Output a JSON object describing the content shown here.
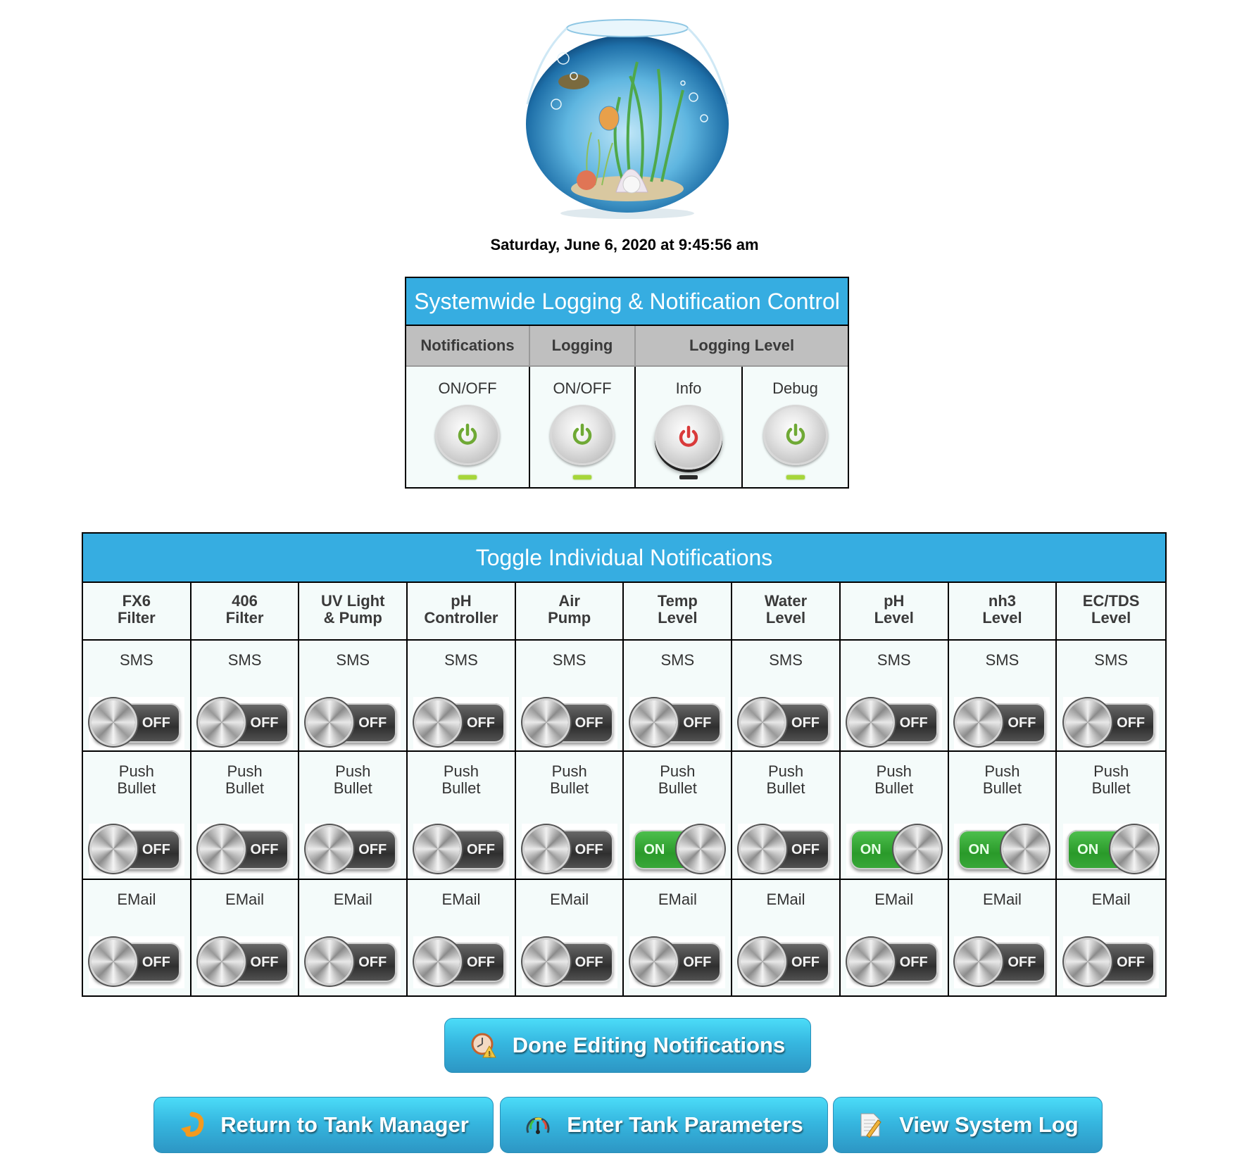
{
  "header": {
    "logo_icon": "fishbowl-aquarium-image",
    "datetime": "Saturday, June 6, 2020 at 9:45:56 am"
  },
  "systemwide": {
    "title": "Systemwide Logging & Notification Control",
    "headers": [
      "Notifications",
      "Logging",
      "Logging Level"
    ],
    "controls": [
      {
        "label": "ON/OFF",
        "group": "Notifications",
        "state": "on",
        "icon_color": "#6fa935",
        "icon": "power-icon"
      },
      {
        "label": "ON/OFF",
        "group": "Logging",
        "state": "on",
        "icon_color": "#6fa935",
        "icon": "power-icon"
      },
      {
        "label": "Info",
        "group": "Logging Level",
        "state": "off",
        "icon_color": "#d93a3a",
        "icon": "power-icon"
      },
      {
        "label": "Debug",
        "group": "Logging Level",
        "state": "on",
        "icon_color": "#6fa935",
        "icon": "power-icon"
      }
    ]
  },
  "individual": {
    "title": "Toggle Individual Notifications",
    "columns": [
      {
        "line1": "FX6",
        "line2": "Filter"
      },
      {
        "line1": "406",
        "line2": "Filter"
      },
      {
        "line1": "UV Light",
        "line2": "& Pump"
      },
      {
        "line1": "pH",
        "line2": "Controller"
      },
      {
        "line1": "Air",
        "line2": "Pump"
      },
      {
        "line1": "Temp",
        "line2": "Level"
      },
      {
        "line1": "Water",
        "line2": "Level"
      },
      {
        "line1": "pH",
        "line2": "Level"
      },
      {
        "line1": "nh3",
        "line2": "Level"
      },
      {
        "line1": "EC/TDS",
        "line2": "Level"
      }
    ],
    "rows": [
      {
        "label1": "SMS",
        "label2": "",
        "states": [
          "OFF",
          "OFF",
          "OFF",
          "OFF",
          "OFF",
          "OFF",
          "OFF",
          "OFF",
          "OFF",
          "OFF"
        ]
      },
      {
        "label1": "Push",
        "label2": "Bullet",
        "states": [
          "OFF",
          "OFF",
          "OFF",
          "OFF",
          "OFF",
          "ON",
          "OFF",
          "ON",
          "ON",
          "ON"
        ]
      },
      {
        "label1": "EMail",
        "label2": "",
        "states": [
          "OFF",
          "OFF",
          "OFF",
          "OFF",
          "OFF",
          "OFF",
          "OFF",
          "OFF",
          "OFF",
          "OFF"
        ]
      }
    ]
  },
  "buttons": {
    "done": {
      "label": "Done Editing Notifications",
      "icon": "clock-warning-icon"
    },
    "return": {
      "label": "Return to Tank Manager",
      "icon": "return-arrow-icon"
    },
    "enter": {
      "label": "Enter Tank Parameters",
      "icon": "gauge-icon"
    },
    "view": {
      "label": "View System Log",
      "icon": "notepad-pencil-icon"
    }
  },
  "colors": {
    "header_blue": "#36ade1",
    "subheader_gray": "#bfbfbf",
    "cell_bg": "#f4fbfa",
    "toggle_on": "#2a9a2a",
    "led_on": "#a6d63a"
  }
}
